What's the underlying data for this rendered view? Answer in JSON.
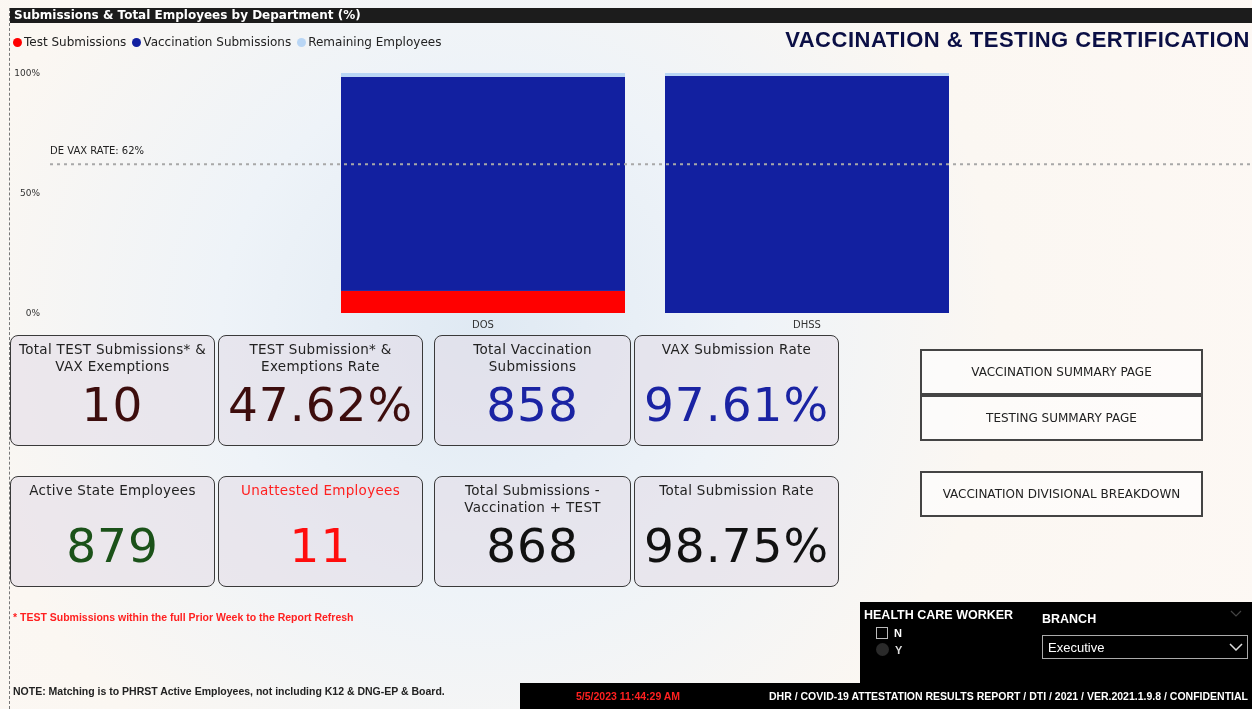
{
  "chart_panel": {
    "header": "Submissions & Total Employees by Department (%)",
    "chart_data": {
      "type": "bar",
      "stacked": true,
      "orientation": "vertical",
      "categories": [
        "DOS",
        "DHSS"
      ],
      "series": [
        {
          "name": "Test Submissions",
          "color": "#ff0000",
          "values": [
            9.2,
            0
          ]
        },
        {
          "name": "Vaccination Submissions",
          "color": "#1220a0",
          "values": [
            89.2,
            98.8
          ]
        },
        {
          "name": "Remaining Employees",
          "color": "#b9d6f5",
          "values": [
            1.6,
            1.2
          ]
        }
      ],
      "ylim": [
        0,
        100
      ],
      "yticks": [
        {
          "value": 0,
          "label": "0%"
        },
        {
          "value": 50,
          "label": "50%"
        },
        {
          "value": 100,
          "label": "100%"
        }
      ],
      "ref_lines": [
        {
          "axis": "y",
          "value": 62,
          "label": "DE VAX RATE: 62%"
        }
      ]
    }
  },
  "title": "VACCINATION & TESTING CERTIFICATION",
  "cards": [
    {
      "label": "Total TEST Submissions* & VAX Exemptions",
      "value": "10",
      "color": "#3d0d0d",
      "label_alert": false
    },
    {
      "label": "TEST Submission* & Exemptions Rate",
      "value": "47.62%",
      "color": "#3d0d0d",
      "label_alert": false
    },
    {
      "label": "Total Vaccination Submissions",
      "value": "858",
      "color": "#1a23a3",
      "label_alert": false
    },
    {
      "label": "VAX Submission Rate",
      "value": "97.61%",
      "color": "#1a23a3",
      "label_alert": false
    },
    {
      "label": "Active State Employees",
      "value": "879",
      "color": "#1b5219",
      "label_alert": false
    },
    {
      "label": "Unattested Employees",
      "value": "11",
      "color": "#ff0d0d",
      "label_alert": true
    },
    {
      "label": "Total Submissions - Vaccination + TEST",
      "value": "868",
      "color": "#111111",
      "label_alert": false
    },
    {
      "label": "Total Submission Rate",
      "value": "98.75%",
      "color": "#111111",
      "label_alert": false
    }
  ],
  "nav_buttons": [
    {
      "label": "VACCINATION SUMMARY PAGE"
    },
    {
      "label": "TESTING SUMMARY PAGE"
    },
    {
      "label": "VACCINATION DIVISIONAL BREAKDOWN"
    }
  ],
  "footnote": "* TEST Submissions within the full Prior Week to the Report Refresh",
  "note": "NOTE: Matching is to PHRST Active Employees, not including K12 & DNG-EP & Board.",
  "health_care_worker": {
    "title": "HEALTH CARE WORKER",
    "options": [
      {
        "label": "N",
        "checked": false,
        "disabled": false
      },
      {
        "label": "Y",
        "checked": false,
        "disabled": true
      }
    ]
  },
  "branch": {
    "title": "BRANCH",
    "value": "Executive"
  },
  "footer": {
    "timestamp": "5/5/2023 11:44:29 AM",
    "text": "DHR / COVID-19 ATTESTATION RESULTS REPORT / DTI / 2021 / VER.2021.1.9.8 / CONFIDENTIAL"
  }
}
